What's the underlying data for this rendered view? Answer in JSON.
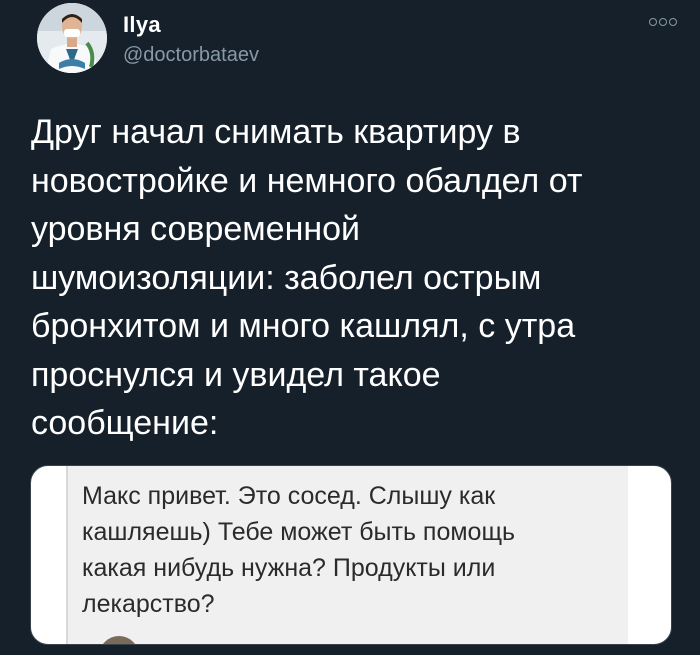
{
  "author": {
    "name": "Ilya",
    "handle": "@doctorbataev",
    "avatar_icon": "doctor-avatar"
  },
  "more_icon": "more-options-icon",
  "tweet": {
    "text": "Друг начал снимать квартиру в\nновостройке и немного обалдел от\nуровня современной\nшумоизоляции: заболел острым\nбронхитом и много кашлял, с утра\nпроснулся и увидел такое\nсообщение:"
  },
  "media": {
    "message_text": "Макс привет. Это сосед. Слышу как\nкашляешь) Тебе может быть помощь\nкакая нибудь нужна? Продукты или\nлекарство?"
  },
  "colors": {
    "background": "#15202b",
    "handle": "#8899a6",
    "message_bg": "#f0f0f0"
  }
}
